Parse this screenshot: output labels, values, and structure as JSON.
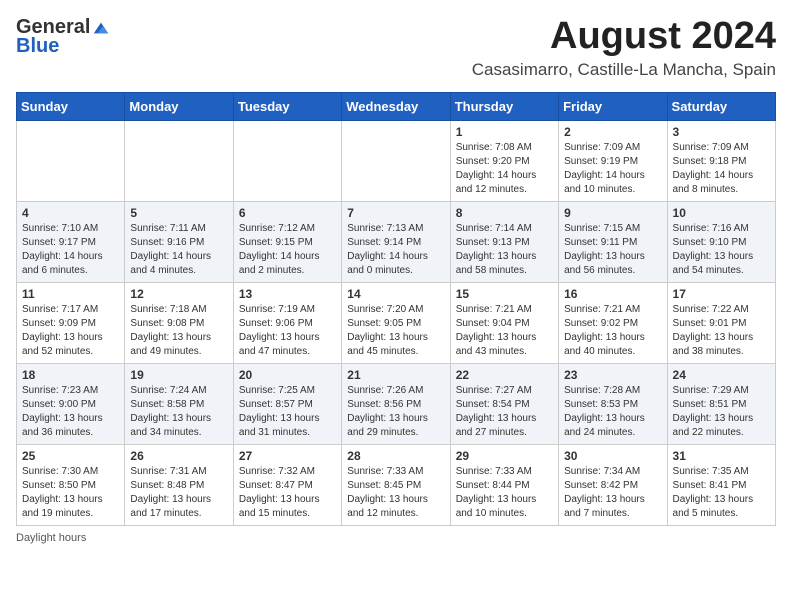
{
  "header": {
    "logo_general": "General",
    "logo_blue": "Blue",
    "month_year": "August 2024",
    "location": "Casasimarro, Castille-La Mancha, Spain"
  },
  "columns": [
    "Sunday",
    "Monday",
    "Tuesday",
    "Wednesday",
    "Thursday",
    "Friday",
    "Saturday"
  ],
  "weeks": [
    [
      {
        "day": "",
        "info": ""
      },
      {
        "day": "",
        "info": ""
      },
      {
        "day": "",
        "info": ""
      },
      {
        "day": "",
        "info": ""
      },
      {
        "day": "1",
        "info": "Sunrise: 7:08 AM\nSunset: 9:20 PM\nDaylight: 14 hours and 12 minutes."
      },
      {
        "day": "2",
        "info": "Sunrise: 7:09 AM\nSunset: 9:19 PM\nDaylight: 14 hours and 10 minutes."
      },
      {
        "day": "3",
        "info": "Sunrise: 7:09 AM\nSunset: 9:18 PM\nDaylight: 14 hours and 8 minutes."
      }
    ],
    [
      {
        "day": "4",
        "info": "Sunrise: 7:10 AM\nSunset: 9:17 PM\nDaylight: 14 hours and 6 minutes."
      },
      {
        "day": "5",
        "info": "Sunrise: 7:11 AM\nSunset: 9:16 PM\nDaylight: 14 hours and 4 minutes."
      },
      {
        "day": "6",
        "info": "Sunrise: 7:12 AM\nSunset: 9:15 PM\nDaylight: 14 hours and 2 minutes."
      },
      {
        "day": "7",
        "info": "Sunrise: 7:13 AM\nSunset: 9:14 PM\nDaylight: 14 hours and 0 minutes."
      },
      {
        "day": "8",
        "info": "Sunrise: 7:14 AM\nSunset: 9:13 PM\nDaylight: 13 hours and 58 minutes."
      },
      {
        "day": "9",
        "info": "Sunrise: 7:15 AM\nSunset: 9:11 PM\nDaylight: 13 hours and 56 minutes."
      },
      {
        "day": "10",
        "info": "Sunrise: 7:16 AM\nSunset: 9:10 PM\nDaylight: 13 hours and 54 minutes."
      }
    ],
    [
      {
        "day": "11",
        "info": "Sunrise: 7:17 AM\nSunset: 9:09 PM\nDaylight: 13 hours and 52 minutes."
      },
      {
        "day": "12",
        "info": "Sunrise: 7:18 AM\nSunset: 9:08 PM\nDaylight: 13 hours and 49 minutes."
      },
      {
        "day": "13",
        "info": "Sunrise: 7:19 AM\nSunset: 9:06 PM\nDaylight: 13 hours and 47 minutes."
      },
      {
        "day": "14",
        "info": "Sunrise: 7:20 AM\nSunset: 9:05 PM\nDaylight: 13 hours and 45 minutes."
      },
      {
        "day": "15",
        "info": "Sunrise: 7:21 AM\nSunset: 9:04 PM\nDaylight: 13 hours and 43 minutes."
      },
      {
        "day": "16",
        "info": "Sunrise: 7:21 AM\nSunset: 9:02 PM\nDaylight: 13 hours and 40 minutes."
      },
      {
        "day": "17",
        "info": "Sunrise: 7:22 AM\nSunset: 9:01 PM\nDaylight: 13 hours and 38 minutes."
      }
    ],
    [
      {
        "day": "18",
        "info": "Sunrise: 7:23 AM\nSunset: 9:00 PM\nDaylight: 13 hours and 36 minutes."
      },
      {
        "day": "19",
        "info": "Sunrise: 7:24 AM\nSunset: 8:58 PM\nDaylight: 13 hours and 34 minutes."
      },
      {
        "day": "20",
        "info": "Sunrise: 7:25 AM\nSunset: 8:57 PM\nDaylight: 13 hours and 31 minutes."
      },
      {
        "day": "21",
        "info": "Sunrise: 7:26 AM\nSunset: 8:56 PM\nDaylight: 13 hours and 29 minutes."
      },
      {
        "day": "22",
        "info": "Sunrise: 7:27 AM\nSunset: 8:54 PM\nDaylight: 13 hours and 27 minutes."
      },
      {
        "day": "23",
        "info": "Sunrise: 7:28 AM\nSunset: 8:53 PM\nDaylight: 13 hours and 24 minutes."
      },
      {
        "day": "24",
        "info": "Sunrise: 7:29 AM\nSunset: 8:51 PM\nDaylight: 13 hours and 22 minutes."
      }
    ],
    [
      {
        "day": "25",
        "info": "Sunrise: 7:30 AM\nSunset: 8:50 PM\nDaylight: 13 hours and 19 minutes."
      },
      {
        "day": "26",
        "info": "Sunrise: 7:31 AM\nSunset: 8:48 PM\nDaylight: 13 hours and 17 minutes."
      },
      {
        "day": "27",
        "info": "Sunrise: 7:32 AM\nSunset: 8:47 PM\nDaylight: 13 hours and 15 minutes."
      },
      {
        "day": "28",
        "info": "Sunrise: 7:33 AM\nSunset: 8:45 PM\nDaylight: 13 hours and 12 minutes."
      },
      {
        "day": "29",
        "info": "Sunrise: 7:33 AM\nSunset: 8:44 PM\nDaylight: 13 hours and 10 minutes."
      },
      {
        "day": "30",
        "info": "Sunrise: 7:34 AM\nSunset: 8:42 PM\nDaylight: 13 hours and 7 minutes."
      },
      {
        "day": "31",
        "info": "Sunrise: 7:35 AM\nSunset: 8:41 PM\nDaylight: 13 hours and 5 minutes."
      }
    ]
  ],
  "footer": {
    "note": "Daylight hours"
  }
}
